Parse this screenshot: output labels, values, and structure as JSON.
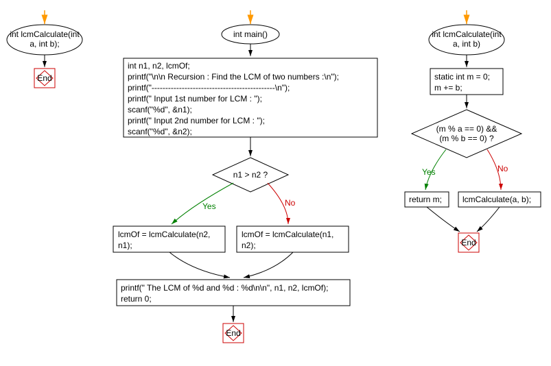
{
  "flowchart1": {
    "terminal": "int lcmCalculate(int a, int b);",
    "end": "End"
  },
  "flowchart2": {
    "terminal": "int main()",
    "process1_l1": "int n1, n2, lcmOf;",
    "process1_l2": "printf(\"\\n\\n Recursion : Find the LCM of two numbers :\\n\");",
    "process1_l3": "printf(\"---------------------------------------------\\n\");",
    "process1_l4": "printf(\" Input 1st number for LCM : \");",
    "process1_l5": "scanf(\"%d\", &n1);",
    "process1_l6": "printf(\" Input 2nd number for LCM : \");",
    "process1_l7": "scanf(\"%d\", &n2);",
    "decision": "n1 > n2 ?",
    "process_yes_l1": "lcmOf = lcmCalculate(n2,",
    "process_yes_l2": "n1);",
    "process_no_l1": "lcmOf = lcmCalculate(n1,",
    "process_no_l2": "n2);",
    "process_final_l1": "printf(\" The LCM of %d and %d :   %d\\n\\n\", n1, n2, lcmOf);",
    "process_final_l2": "return 0;",
    "end": "End"
  },
  "flowchart3": {
    "terminal": "int lcmCalculate(int a, int b)",
    "process1_l1": "static int m = 0;",
    "process1_l2": "m += b;",
    "decision_l1": "(m % a == 0)  &&",
    "decision_l2": "(m % b == 0)  ?",
    "process_yes": "return m;",
    "process_no": "lcmCalculate(a, b);",
    "end": "End"
  },
  "labels": {
    "yes": "Yes",
    "no": "No"
  }
}
